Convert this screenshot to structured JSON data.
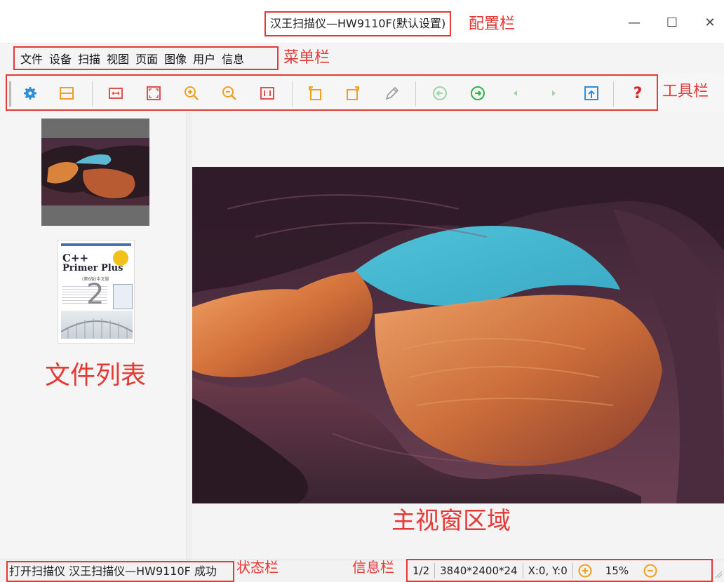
{
  "window": {
    "title": "汉王扫描仪—HW9110F(默认设置)",
    "controls": {
      "minimize": "—",
      "maximize": "☐",
      "close": "✕"
    }
  },
  "menu": {
    "items": [
      "文件",
      "设备",
      "扫描",
      "视图",
      "页面",
      "图像",
      "用户",
      "信息"
    ]
  },
  "toolbar": {
    "icons": [
      "gear-icon",
      "scan-area-icon",
      "fit-width-icon",
      "fit-page-icon",
      "zoom-in-icon",
      "zoom-out-icon",
      "actual-size-icon",
      "rotate-left-icon",
      "rotate-right-icon",
      "edit-pen-icon",
      "prev-page-circle-icon",
      "next-page-circle-icon",
      "prev-arrow-icon",
      "next-arrow-icon",
      "export-icon",
      "help-icon"
    ]
  },
  "sidebar": {
    "thumbnails": [
      {
        "label": ""
      },
      {
        "label": "2",
        "cover_title_line1": "C++",
        "cover_title_line2": "Primer Plus",
        "cover_sub": "(第6版)中文版"
      }
    ]
  },
  "statusbar": {
    "message": "打开扫描仪 汉王扫描仪—HW9110F 成功"
  },
  "infobar": {
    "page": "1/2",
    "image_info": "3840*2400*24",
    "coords": "X:0, Y:0",
    "zoom": "15%"
  },
  "annotations": {
    "title_bar": "配置栏",
    "menu_bar": "菜单栏",
    "toolbar": "工具栏",
    "file_list": "文件列表",
    "main_view": "主视窗区域",
    "status_bar": "状态栏",
    "info_bar": "信息栏"
  },
  "colors": {
    "annotation_red": "#e53935",
    "icon_orange": "#f0a020",
    "icon_green": "#2db34a",
    "icon_blue": "#2d8fd8",
    "help_red": "#e02020"
  }
}
